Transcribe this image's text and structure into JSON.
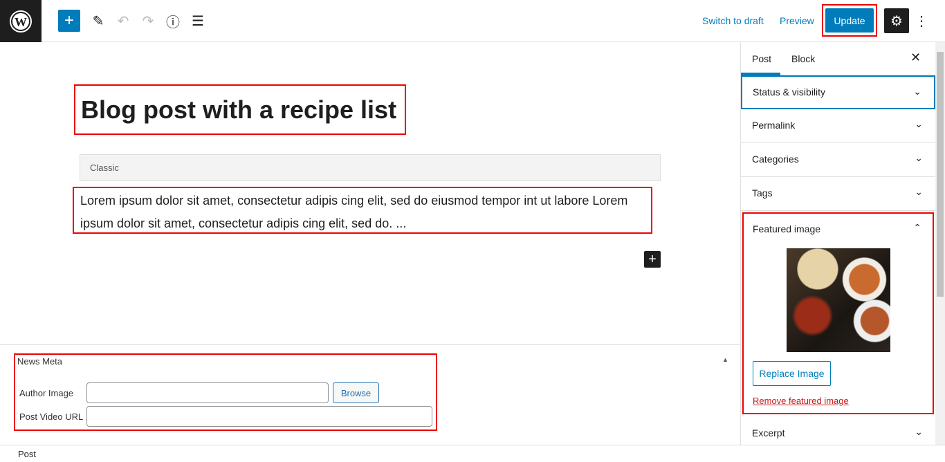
{
  "toolbar": {
    "switch_draft": "Switch to draft",
    "preview": "Preview",
    "update": "Update"
  },
  "editor": {
    "title": "Blog post with a recipe list",
    "classic_label": "Classic",
    "paragraph": "Lorem ipsum dolor sit amet, consectetur adipis cing elit, sed do eiusmod tempor int ut labore Lorem ipsum dolor sit amet, consectetur adipis cing elit, sed do. ..."
  },
  "meta": {
    "title": "News Meta",
    "author_image_label": "Author Image",
    "author_image_value": "",
    "browse": "Browse",
    "video_label": "Post Video URL",
    "video_value": ""
  },
  "footer": {
    "breadcrumb": "Post"
  },
  "sidebar": {
    "tabs": [
      "Post",
      "Block"
    ],
    "panels": [
      "Status & visibility",
      "Permalink",
      "Categories",
      "Tags"
    ],
    "featured": {
      "title": "Featured image",
      "replace": "Replace Image",
      "remove": "Remove featured image"
    },
    "excerpt": "Excerpt"
  },
  "colors": {
    "accent": "#007cba",
    "highlight": "#ee0000",
    "danger": "#cc1818"
  }
}
